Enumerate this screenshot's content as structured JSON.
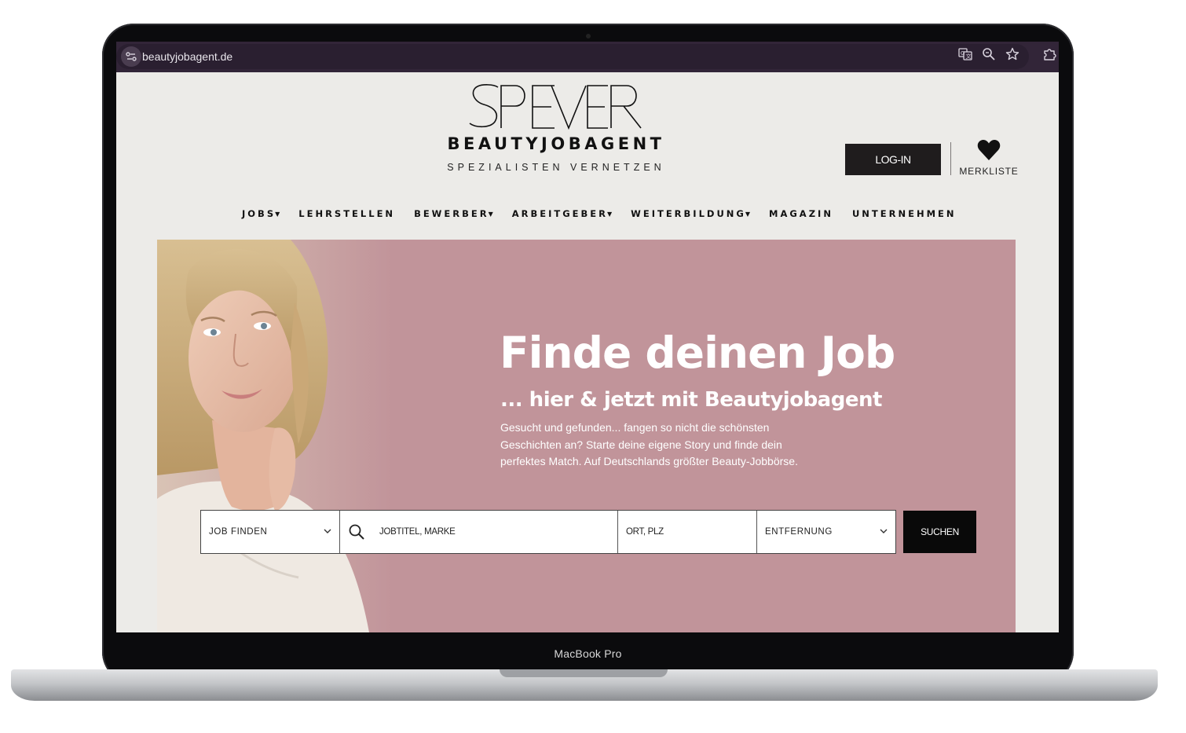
{
  "device": {
    "model_label": "MacBook Pro"
  },
  "browser": {
    "url": "beautyjobagent.de",
    "icons": [
      "site-info-icon",
      "translate-icon",
      "zoom-icon",
      "bookmark-star-icon",
      "extensions-icon"
    ]
  },
  "header": {
    "logo_wordmark": "SPEYER",
    "brand": "BEAUTYJOBAGENT",
    "tagline": "SPEZIALISTEN VERNETZEN",
    "login_label": "LOG-IN",
    "wishlist_label": "MERKLISTE"
  },
  "nav": {
    "items": [
      {
        "label": "JOBS",
        "dropdown": true
      },
      {
        "label": "LEHRSTELLEN",
        "dropdown": false
      },
      {
        "label": "BEWERBER",
        "dropdown": true
      },
      {
        "label": "ARBEITGEBER",
        "dropdown": true
      },
      {
        "label": "WEITERBILDUNG",
        "dropdown": true
      },
      {
        "label": "MAGAZIN",
        "dropdown": false
      },
      {
        "label": "UNTERNEHMEN",
        "dropdown": false
      }
    ]
  },
  "hero": {
    "title": "Finde deinen Job",
    "subtitle": "... hier & jetzt mit Beautyjobagent",
    "text": "Gesucht und gefunden... fangen so nicht die schönsten Geschichten an? Starte deine eigene Story und finde dein perfektes Match. Auf Deutschlands größter Beauty-Jobbörse.",
    "background_color": "#c1949a"
  },
  "search": {
    "category_value": "JOB FINDEN",
    "keyword_placeholder": "JOBTITEL, MARKE",
    "location_placeholder": "ORT, PLZ",
    "distance_value": "ENTFERNUNG",
    "submit_label": "SUCHEN"
  }
}
